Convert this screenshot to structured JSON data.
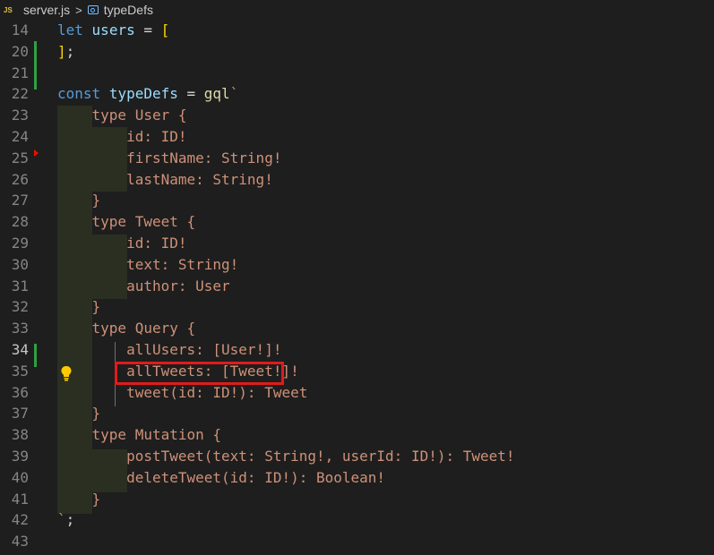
{
  "breadcrumb": {
    "file_badge": "JS",
    "file_name": "server.js",
    "separator": ">",
    "symbol": "typeDefs"
  },
  "editor": {
    "active_line": "34",
    "lines": [
      {
        "n": "14",
        "tokens": [
          [
            "kw",
            "let"
          ],
          [
            "op",
            " "
          ],
          [
            "var",
            "users"
          ],
          [
            "op",
            " = "
          ],
          [
            "br",
            "["
          ]
        ]
      },
      {
        "n": "20",
        "tokens": [
          [
            "br",
            "]"
          ],
          [
            "op",
            ";"
          ]
        ]
      },
      {
        "n": "21",
        "tokens": []
      },
      {
        "n": "22",
        "tokens": [
          [
            "kw",
            "const"
          ],
          [
            "op",
            " "
          ],
          [
            "var",
            "typeDefs"
          ],
          [
            "op",
            " = "
          ],
          [
            "fn",
            "gql"
          ],
          [
            "tpl",
            "`"
          ]
        ]
      },
      {
        "n": "23",
        "tokens": [
          [
            "tpl",
            "    type User {"
          ]
        ]
      },
      {
        "n": "24",
        "tokens": [
          [
            "tpl",
            "        id: ID!"
          ]
        ]
      },
      {
        "n": "25",
        "tokens": [
          [
            "tpl",
            "        firstName: String!"
          ]
        ]
      },
      {
        "n": "26",
        "tokens": [
          [
            "tpl",
            "        lastName: String!"
          ]
        ]
      },
      {
        "n": "27",
        "tokens": [
          [
            "tpl",
            "    }"
          ]
        ]
      },
      {
        "n": "28",
        "tokens": [
          [
            "tpl",
            "    type Tweet {"
          ]
        ]
      },
      {
        "n": "29",
        "tokens": [
          [
            "tpl",
            "        id: ID!"
          ]
        ]
      },
      {
        "n": "30",
        "tokens": [
          [
            "tpl",
            "        text: String!"
          ]
        ]
      },
      {
        "n": "31",
        "tokens": [
          [
            "tpl",
            "        author: User"
          ]
        ]
      },
      {
        "n": "32",
        "tokens": [
          [
            "tpl",
            "    }"
          ]
        ]
      },
      {
        "n": "33",
        "tokens": [
          [
            "tpl",
            "    type Query {"
          ]
        ]
      },
      {
        "n": "34",
        "tokens": [
          [
            "tpl",
            "        allUsers: [User!]!"
          ]
        ]
      },
      {
        "n": "35",
        "tokens": [
          [
            "tpl",
            "        allTweets: [Tweet!]!"
          ]
        ]
      },
      {
        "n": "36",
        "tokens": [
          [
            "tpl",
            "        tweet(id: ID!): Tweet"
          ]
        ]
      },
      {
        "n": "37",
        "tokens": [
          [
            "tpl",
            "    }"
          ]
        ]
      },
      {
        "n": "38",
        "tokens": [
          [
            "tpl",
            "    type Mutation {"
          ]
        ]
      },
      {
        "n": "39",
        "tokens": [
          [
            "tpl",
            "        postTweet(text: String!, userId: ID!): Tweet!"
          ]
        ]
      },
      {
        "n": "40",
        "tokens": [
          [
            "tpl",
            "        deleteTweet(id: ID!): Boolean!"
          ]
        ]
      },
      {
        "n": "41",
        "tokens": [
          [
            "tpl",
            "    }"
          ]
        ]
      },
      {
        "n": "42",
        "tokens": [
          [
            "tpl",
            "`"
          ],
          [
            "op",
            ";"
          ]
        ]
      },
      {
        "n": "43",
        "tokens": []
      }
    ]
  },
  "colors": {
    "background": "#1e1e1e",
    "keyword": "#569cd6",
    "variable": "#9cdcfe",
    "function": "#dcdcaa",
    "string": "#ce9178",
    "bracket": "#ffd700",
    "highlight_box": "#e01b1b",
    "git_added": "#2ea043",
    "git_deleted": "#e51400",
    "lightbulb": "#ffcc00"
  },
  "icons": {
    "lightbulb": "lightbulb-icon",
    "symbol": "symbol-variable-icon"
  }
}
